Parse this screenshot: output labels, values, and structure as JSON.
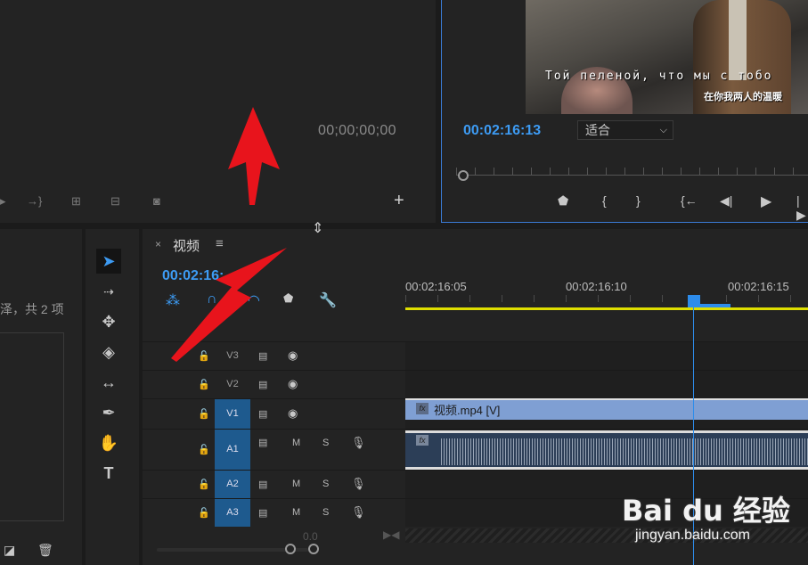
{
  "source_monitor": {
    "timecode": "00;00;00;00",
    "buttons": [
      "insert-icon",
      "overwrite-icon",
      "lift-icon",
      "export-frame-icon",
      "add-button-icon"
    ],
    "add_label": "+"
  },
  "program_monitor": {
    "subtitle_ru": "Той пеленой, что мы с тобо",
    "subtitle_zh": "在你我两人的温暖",
    "timecode": "00:02:16:13",
    "fit_select": "适合",
    "fit_chevron": "⌵",
    "transport": [
      {
        "name": "marker-icon",
        "glyph": "⬟"
      },
      {
        "name": "mark-in-icon",
        "glyph": "{"
      },
      {
        "name": "mark-out-icon",
        "glyph": "}"
      },
      {
        "name": "go-to-in-icon",
        "glyph": "{←"
      },
      {
        "name": "step-back-icon",
        "glyph": "◀|"
      },
      {
        "name": "play-icon",
        "glyph": "▶"
      },
      {
        "name": "step-forward-icon",
        "glyph": "|▶"
      }
    ]
  },
  "project_panel": {
    "item_count_text": "泽，共 2 项"
  },
  "timeline": {
    "close": "×",
    "title": "视频",
    "menu": "≡",
    "timecode": "00:02:16:",
    "ruler_labels": [
      "00:02:16:05",
      "00:02:16:10",
      "00:02:16:15"
    ],
    "tracks": {
      "video": [
        {
          "name": "V3",
          "selected": false
        },
        {
          "name": "V2",
          "selected": false
        },
        {
          "name": "V1",
          "selected": true
        }
      ],
      "audio": [
        {
          "name": "A1",
          "selected": true,
          "m": "M",
          "s": "S"
        },
        {
          "name": "A2",
          "selected": true,
          "m": "M",
          "s": "S"
        },
        {
          "name": "A3",
          "selected": true,
          "m": "M",
          "s": "S"
        }
      ]
    },
    "clip_v1_name": "视频.mp4 [V]",
    "fx_label": "fx",
    "zero_value": "0.0"
  },
  "watermark": {
    "logo_text": "Bai du 经验",
    "url": "jingyan.baidu.com"
  },
  "colors": {
    "accent_blue": "#3d9bf3",
    "work_area_yellow": "#dede00",
    "annotation_red": "#e8141c"
  }
}
